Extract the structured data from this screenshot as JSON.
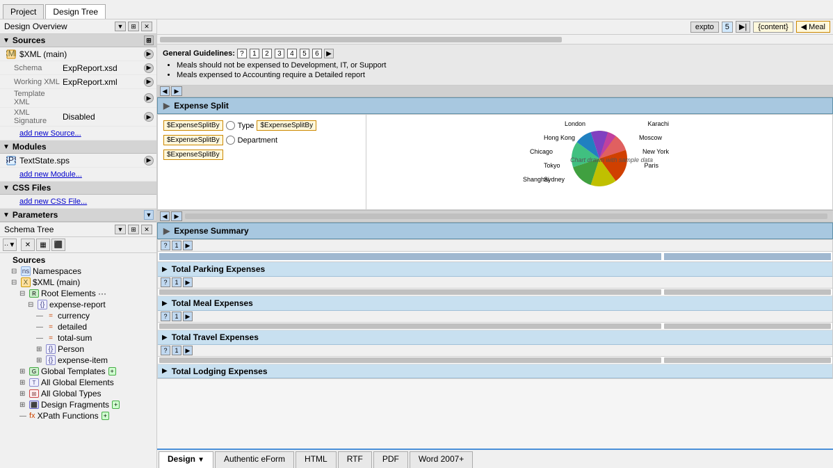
{
  "tabs": {
    "project_label": "Project",
    "design_tree_label": "Design Tree"
  },
  "left_panel": {
    "header": "Design Overview",
    "header_btns": [
      "▼",
      "⊞",
      "✕"
    ],
    "sources_section": "Sources",
    "xml_main_label": "$XML (main)",
    "schema_label": "Schema",
    "schema_value": "ExpReport.xsd",
    "working_xml_label": "Working XML",
    "working_xml_value": "ExpReport.xml",
    "template_xml_label": "Template XML",
    "xml_signature_label": "XML Signature",
    "xml_signature_value": "Disabled",
    "add_source_link": "add new Source...",
    "modules_section": "Modules",
    "textstate_label": "TextState.sps",
    "add_module_link": "add new Module...",
    "css_section": "CSS Files",
    "add_css_link": "add new CSS File...",
    "parameters_section": "Parameters"
  },
  "schema_tree": {
    "header": "Schema Tree",
    "header_btns": [
      "▼",
      "⊞",
      "✕"
    ],
    "toolbar_btns": [
      "...",
      "✕",
      "⊞",
      "▦"
    ],
    "sources_label": "Sources",
    "items": [
      {
        "level": 1,
        "expand": "⊟",
        "icon": "ns",
        "label": "Namespaces"
      },
      {
        "level": 1,
        "expand": "⊟",
        "icon": "xml-src",
        "label": "$XML (main)"
      },
      {
        "level": 2,
        "expand": "⊟",
        "icon": "root",
        "label": "Root Elements ···"
      },
      {
        "level": 3,
        "expand": "⊟",
        "icon": "elem",
        "label": "expense-report"
      },
      {
        "level": 4,
        "expand": "—",
        "icon": "attr",
        "label": "currency"
      },
      {
        "level": 4,
        "expand": "—",
        "icon": "attr",
        "label": "detailed"
      },
      {
        "level": 4,
        "expand": "—",
        "icon": "attr",
        "label": "total-sum"
      },
      {
        "level": 4,
        "expand": "⊞",
        "icon": "elem",
        "label": "Person"
      },
      {
        "level": 4,
        "expand": "⊞",
        "icon": "elem",
        "label": "expense-item"
      },
      {
        "level": 2,
        "expand": "⊞",
        "icon": "root",
        "label": "Global Templates"
      },
      {
        "level": 2,
        "expand": "⊞",
        "icon": "elem",
        "label": "All Global Elements"
      },
      {
        "level": 2,
        "expand": "⊞",
        "icon": "elem",
        "label": "All Global Types"
      },
      {
        "level": 2,
        "expand": "⊞",
        "icon": "elem",
        "label": "Design Fragments"
      },
      {
        "level": 2,
        "expand": "—",
        "icon": "func",
        "label": "XPath Functions"
      }
    ]
  },
  "content": {
    "guidelines": {
      "label": "General Guidelines:",
      "nums": [
        "?",
        "1",
        "2",
        "3",
        "4",
        "5",
        "6"
      ],
      "bullets": [
        "Meals should not be expensed to Development, IT, or Support",
        "Meals expensed to Accounting require a Detailed report"
      ]
    },
    "expense_split": {
      "title": "Expense Split",
      "fields": [
        {
          "field": "$ExpenseSplitBy",
          "radio_label": "Type",
          "field2": "$ExpenseSplitBy"
        },
        {
          "field": "$ExpenseSplitBy",
          "radio_label": "Department"
        },
        {
          "field": "$ExpenseSplitBy"
        }
      ],
      "chart_label": "Chart drawn with sample data",
      "pie_labels": [
        "London",
        "Karachi",
        "Hong Kong",
        "Moscow",
        "Chicago",
        "New York",
        "Tokyo",
        "Paris",
        "Sydney",
        "Shanghai"
      ],
      "pie_colors": [
        "#e8a020",
        "#d04000",
        "#c0c000",
        "#40a040",
        "#40c080",
        "#2080c0",
        "#8040c0",
        "#c040a0",
        "#e06060",
        "#60d0a0"
      ]
    },
    "expense_summary": {
      "title": "Expense Summary",
      "rows": [
        "Total Parking Expenses",
        "Total Meal Expenses",
        "Total Travel Expenses",
        "Total Lodging Expenses"
      ]
    }
  },
  "bottom_tabs": {
    "tabs": [
      "Design",
      "Authentic eForm",
      "HTML",
      "RTF",
      "PDF",
      "Word 2007+"
    ]
  }
}
